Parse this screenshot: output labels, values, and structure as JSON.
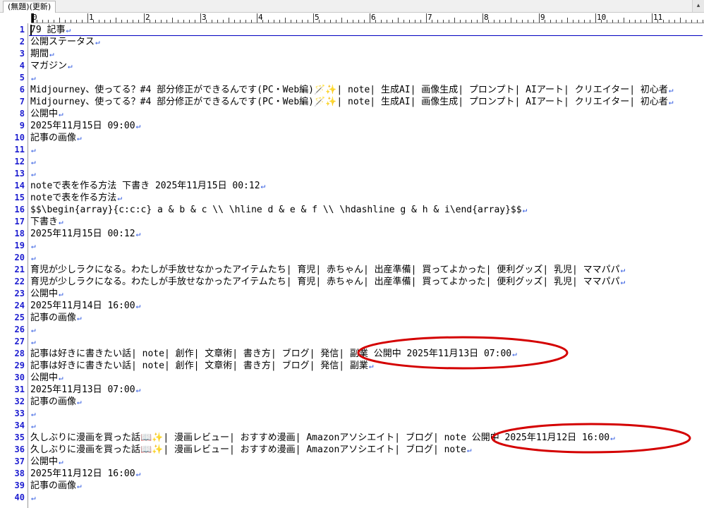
{
  "tab": {
    "title": "(無題)(更新)"
  },
  "ruler": {
    "marks": [
      "0",
      "1",
      "2",
      "3",
      "4",
      "5",
      "6",
      "7",
      "8",
      "9",
      "10",
      "11"
    ]
  },
  "eol_glyph": "↵",
  "lines": [
    {
      "num": "1",
      "text": "79 記事"
    },
    {
      "num": "2",
      "text": "公開ステータス"
    },
    {
      "num": "3",
      "text": "期間"
    },
    {
      "num": "4",
      "text": "マガジン"
    },
    {
      "num": "5",
      "text": ""
    },
    {
      "num": "6",
      "text": "Midjourney、使ってる？#4 部分修正ができるんです(PC・Web編)🪄✨| note| 生成AI| 画像生成| プロンプト| AIアート| クリエイター| 初心者"
    },
    {
      "num": "7",
      "text": "Midjourney、使ってる？#4 部分修正ができるんです(PC・Web編)🪄✨| note| 生成AI| 画像生成| プロンプト| AIアート| クリエイター| 初心者"
    },
    {
      "num": "8",
      "text": "公開中"
    },
    {
      "num": "9",
      "text": "2025年11月15日 09:00"
    },
    {
      "num": "10",
      "text": "記事の画像"
    },
    {
      "num": "11",
      "text": ""
    },
    {
      "num": "12",
      "text": ""
    },
    {
      "num": "13",
      "text": ""
    },
    {
      "num": "14",
      "text": "noteで表を作る方法 下書き 2025年11月15日 00:12"
    },
    {
      "num": "15",
      "text": "noteで表を作る方法"
    },
    {
      "num": "16",
      "text": "$$\\begin{array}{c:c:c} a & b & c \\\\ \\hline d & e & f \\\\ \\hdashline g & h & i\\end{array}$$"
    },
    {
      "num": "17",
      "text": "下書き"
    },
    {
      "num": "18",
      "text": "2025年11月15日 00:12"
    },
    {
      "num": "19",
      "text": ""
    },
    {
      "num": "20",
      "text": ""
    },
    {
      "num": "21",
      "text": "育児が少しラクになる。わたしが手放せなかったアイテムたち| 育児| 赤ちゃん| 出産準備| 買ってよかった| 便利グッズ| 乳児| ママパパ"
    },
    {
      "num": "22",
      "text": "育児が少しラクになる。わたしが手放せなかったアイテムたち| 育児| 赤ちゃん| 出産準備| 買ってよかった| 便利グッズ| 乳児| ママパパ"
    },
    {
      "num": "23",
      "text": "公開中"
    },
    {
      "num": "24",
      "text": "2025年11月14日 16:00"
    },
    {
      "num": "25",
      "text": "記事の画像"
    },
    {
      "num": "26",
      "text": ""
    },
    {
      "num": "27",
      "text": ""
    },
    {
      "num": "28",
      "text": "記事は好きに書きたい話| note| 創作| 文章術| 書き方| ブログ| 発信| 副業 公開中 2025年11月13日 07:00"
    },
    {
      "num": "29",
      "text": "記事は好きに書きたい話| note| 創作| 文章術| 書き方| ブログ| 発信| 副業"
    },
    {
      "num": "30",
      "text": "公開中"
    },
    {
      "num": "31",
      "text": "2025年11月13日 07:00"
    },
    {
      "num": "32",
      "text": "記事の画像"
    },
    {
      "num": "33",
      "text": ""
    },
    {
      "num": "34",
      "text": ""
    },
    {
      "num": "35",
      "text": "久しぶりに漫画を買った話📖✨| 漫画レビュー| おすすめ漫画| Amazonアソシエイト| ブログ| note 公開中 2025年11月12日 16:00"
    },
    {
      "num": "36",
      "text": "久しぶりに漫画を買った話📖✨| 漫画レビュー| おすすめ漫画| Amazonアソシエイト| ブログ| note"
    },
    {
      "num": "37",
      "text": "公開中"
    },
    {
      "num": "38",
      "text": "2025年11月12日 16:00"
    },
    {
      "num": "39",
      "text": "記事の画像"
    },
    {
      "num": "40",
      "text": ""
    }
  ],
  "annotation_color": "#d40000"
}
